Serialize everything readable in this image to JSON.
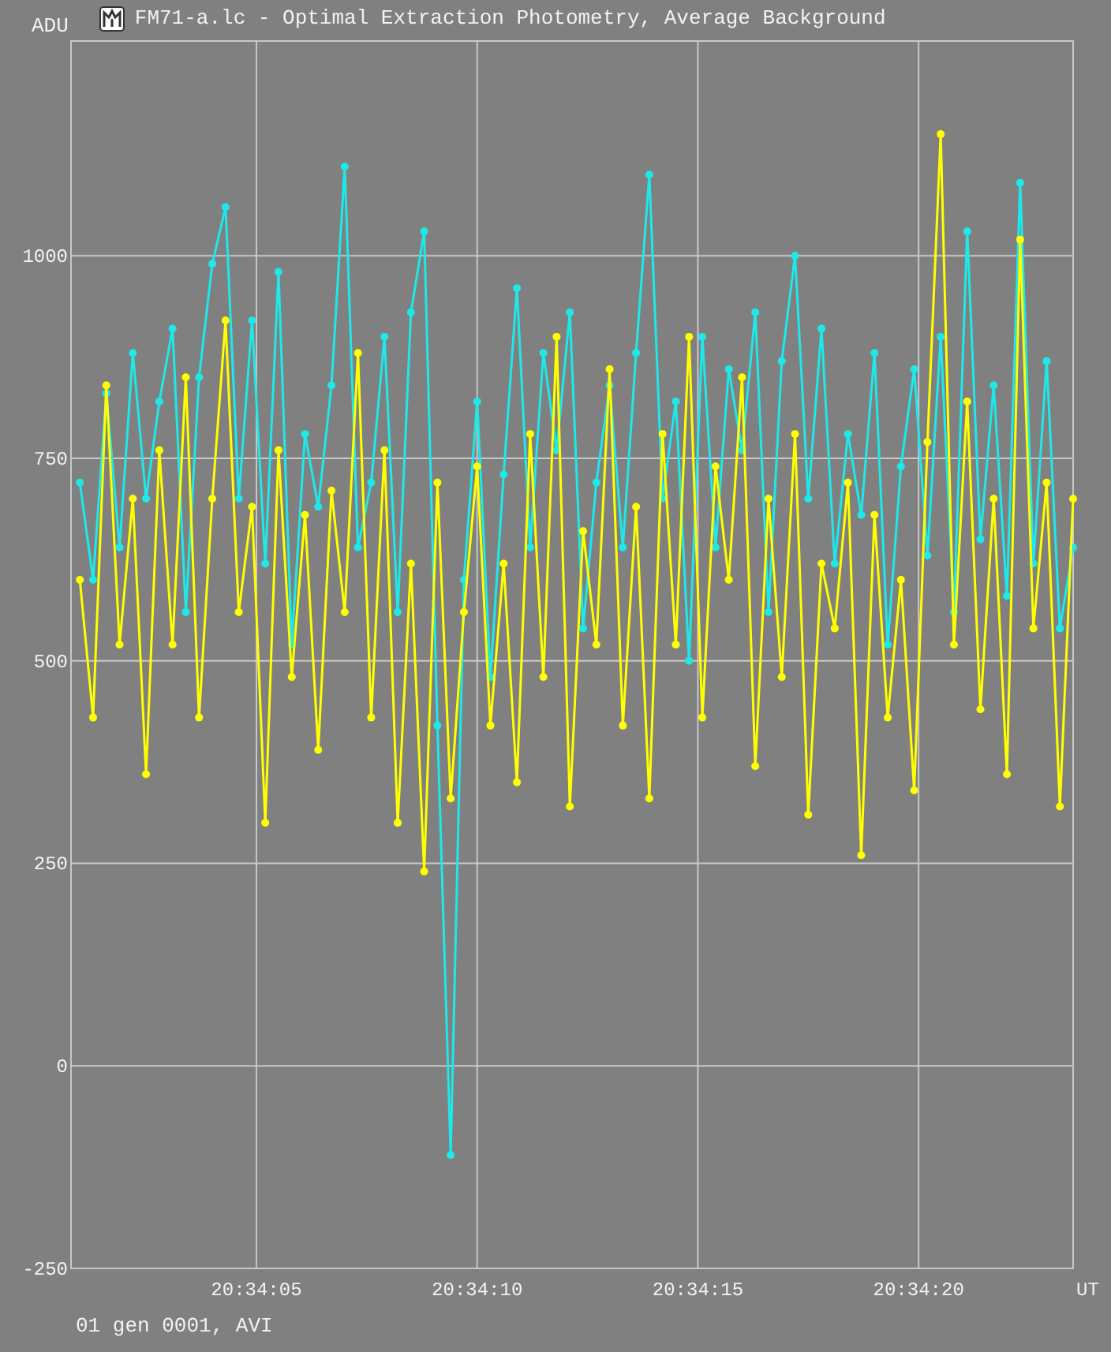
{
  "window": {
    "title": "FM71-a.lc - Optimal Extraction Photometry, Average Background"
  },
  "chart_data": {
    "type": "line",
    "ylabel": "ADU",
    "xlabel": "UT",
    "xlim": [
      74040.8,
      74063.5
    ],
    "grid": true,
    "ylim": [
      -250,
      1265
    ],
    "xticks": [
      {
        "value": 74045,
        "label": "20:34:05"
      },
      {
        "value": 74050,
        "label": "20:34:10"
      },
      {
        "value": 74055,
        "label": "20:34:15"
      },
      {
        "value": 74060,
        "label": "20:34:20"
      }
    ],
    "yticks": [
      -250,
      0,
      250,
      500,
      750,
      1000
    ],
    "x": [
      74041.0,
      74041.3,
      74041.6,
      74041.9,
      74042.2,
      74042.5,
      74042.8,
      74043.1,
      74043.4,
      74043.7,
      74044.0,
      74044.3,
      74044.6,
      74044.9,
      74045.2,
      74045.5,
      74045.8,
      74046.1,
      74046.4,
      74046.7,
      74047.0,
      74047.3,
      74047.6,
      74047.9,
      74048.2,
      74048.5,
      74048.8,
      74049.1,
      74049.4,
      74049.7,
      74050.0,
      74050.3,
      74050.6,
      74050.9,
      74051.2,
      74051.5,
      74051.8,
      74052.1,
      74052.4,
      74052.7,
      74053.0,
      74053.3,
      74053.6,
      74053.9,
      74054.2,
      74054.5,
      74054.8,
      74055.1,
      74055.4,
      74055.7,
      74056.0,
      74056.3,
      74056.6,
      74056.9,
      74057.2,
      74057.5,
      74057.8,
      74058.1,
      74058.4,
      74058.7,
      74059.0,
      74059.3,
      74059.6,
      74059.9,
      74060.2,
      74060.5,
      74060.8,
      74061.1,
      74061.4,
      74061.7,
      74062.0,
      74062.3,
      74062.6,
      74062.9,
      74063.2,
      74063.5
    ],
    "series": [
      {
        "color": "#1ee8e8",
        "marker": "circle",
        "values": [
          720,
          600,
          830,
          640,
          880,
          700,
          820,
          910,
          560,
          850,
          990,
          1060,
          700,
          920,
          620,
          980,
          520,
          780,
          690,
          840,
          1110,
          640,
          720,
          900,
          560,
          930,
          1030,
          420,
          -110,
          600,
          820,
          480,
          730,
          960,
          640,
          880,
          760,
          930,
          540,
          720,
          840,
          640,
          880,
          1100,
          700,
          820,
          500,
          900,
          640,
          860,
          760,
          930,
          560,
          870,
          1000,
          700,
          910,
          620,
          780,
          680,
          880,
          520,
          740,
          860,
          630,
          900,
          560,
          1030,
          650,
          840,
          580,
          1090,
          620,
          870,
          540,
          640
        ]
      },
      {
        "color": "#ffff00",
        "marker": "circle",
        "values": [
          600,
          430,
          840,
          520,
          700,
          360,
          760,
          520,
          850,
          430,
          700,
          920,
          560,
          690,
          300,
          760,
          480,
          680,
          390,
          710,
          560,
          880,
          430,
          760,
          300,
          620,
          240,
          720,
          330,
          560,
          740,
          420,
          620,
          350,
          780,
          480,
          900,
          320,
          660,
          520,
          860,
          420,
          690,
          330,
          780,
          520,
          900,
          430,
          740,
          600,
          850,
          370,
          700,
          480,
          780,
          310,
          620,
          540,
          720,
          260,
          680,
          430,
          600,
          340,
          770,
          1150,
          520,
          820,
          440,
          700,
          360,
          1020,
          540,
          720,
          320,
          700
        ]
      }
    ]
  },
  "footer": "01 gen 0001, AVI"
}
